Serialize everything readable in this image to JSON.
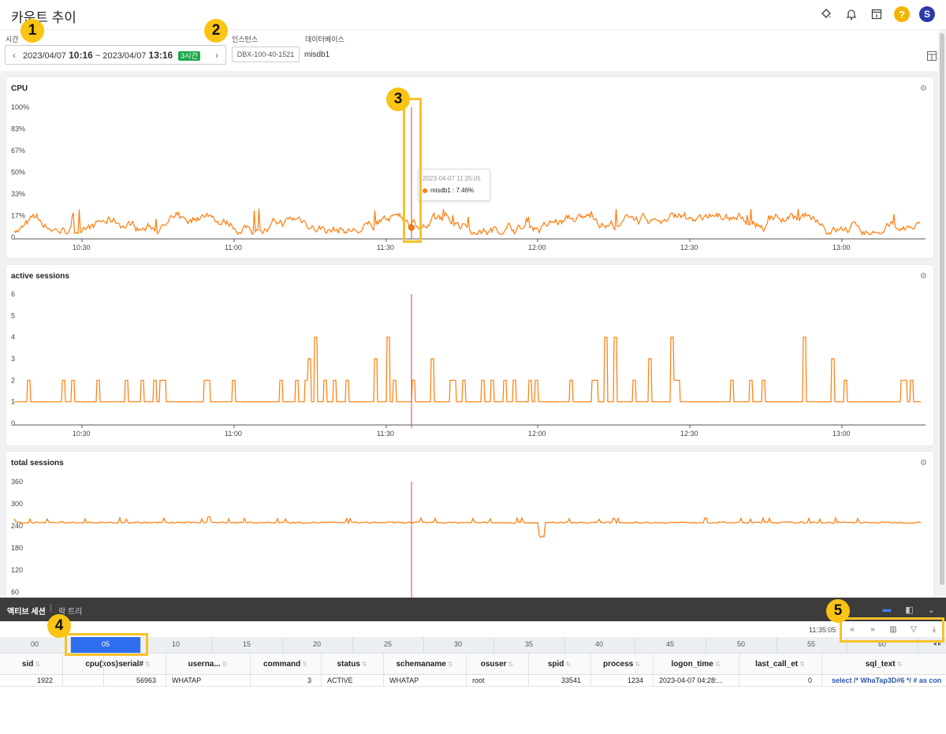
{
  "header": {
    "title": "카운트 추이"
  },
  "filters": {
    "time_label": "시간",
    "time_start_date": "2023/04/07",
    "time_start_hm": "10:16",
    "time_sep": "~",
    "time_end_date": "2023/04/07",
    "time_end_hm": "13:16",
    "time_badge": "3시간",
    "instance_label": "인스턴스",
    "instance_value": "DBX-100-40-1521",
    "database_label": "데이터베이스",
    "database_value": "misdb1"
  },
  "charts": [
    {
      "type": "line",
      "title": "CPU",
      "y_ticks": [
        "100%",
        "83%",
        "67%",
        "50%",
        "33%",
        "17%",
        "0"
      ],
      "ylim": [
        0,
        100
      ],
      "x_ticks": [
        "10:30",
        "11:00",
        "11:30",
        "12:00",
        "12:30",
        "13:00"
      ],
      "series": [
        {
          "values_summary": "fluctuating between 2% and 20%, mostly around 8%"
        }
      ],
      "color": "#ff7c0a"
    },
    {
      "type": "line",
      "title": "active sessions",
      "y_ticks": [
        "6",
        "5",
        "4",
        "3",
        "2",
        "1",
        "0"
      ],
      "ylim": [
        0,
        6
      ],
      "x_ticks": [
        "10:30",
        "11:00",
        "11:30",
        "12:00",
        "12:30",
        "13:00"
      ],
      "color": "#ff7c0a"
    },
    {
      "type": "line",
      "title": "total sessions",
      "y_ticks": [
        "360",
        "300",
        "240",
        "180",
        "120",
        "60"
      ],
      "ylim": [
        60,
        360
      ],
      "x_ticks": [],
      "color": "#ff7c0a"
    }
  ],
  "chart_data": [
    {
      "type": "line",
      "title": "CPU",
      "ylim": [
        0,
        100
      ],
      "yticks": [
        "0",
        "17%",
        "33%",
        "50%",
        "67%",
        "83%",
        "100%"
      ],
      "xticks": [
        "10:30",
        "11:00",
        "11:30",
        "12:00",
        "12:30",
        "13:00"
      ],
      "series": [
        {
          "name": "misdb1",
          "approx_range": [
            2,
            22
          ]
        }
      ],
      "highlight": {
        "time": "2023-04-07 11:35:05",
        "series": "misdb1",
        "value": 7.46
      }
    },
    {
      "type": "line",
      "title": "active sessions",
      "ylim": [
        0,
        6
      ],
      "yticks": [
        "0",
        "1",
        "2",
        "3",
        "4",
        "5",
        "6"
      ],
      "xticks": [
        "10:30",
        "11:00",
        "11:30",
        "12:00",
        "12:30",
        "13:00"
      ],
      "series": [
        {
          "approx_range": [
            1,
            4
          ]
        }
      ]
    },
    {
      "type": "line",
      "title": "total sessions",
      "ylim": [
        60,
        360
      ],
      "yticks": [
        "60",
        "120",
        "180",
        "240",
        "300",
        "360"
      ],
      "series": [
        {
          "approx_range": [
            200,
            265
          ]
        }
      ]
    }
  ],
  "tooltip": {
    "time": "2023-04-07 11:35:05",
    "label": "misdb1 : 7.46%"
  },
  "markers": [
    "1",
    "2",
    "3",
    "4",
    "5"
  ],
  "bottom": {
    "tab_active": "액티브 세션",
    "tab_sep": "|",
    "tab_other": "락 트리",
    "time": "11:35:05",
    "range_ticks": [
      "00",
      "05",
      "10",
      "15",
      "20",
      "25",
      "30",
      "35",
      "40",
      "45",
      "50",
      "55",
      "60"
    ],
    "range_selected": "05"
  },
  "table": {
    "columns": [
      "sid",
      "cpu(xos)",
      "serial#",
      "userna...",
      "command",
      "status",
      "schemaname",
      "osuser",
      "spid",
      "process",
      "logon_time",
      "last_call_et",
      "sql_text"
    ],
    "rows": [
      [
        "1922",
        "",
        "56963",
        "WHATAP",
        "3",
        "ACTIVE",
        "WHATAP",
        "root",
        "33541",
        "1234",
        "2023-04-07 04:28:...",
        "0",
        "select /* WhaTap3D#6 */ # as con"
      ]
    ]
  },
  "colors": {
    "accent": "#ff7c0a",
    "marker": "#f9c414",
    "badge": "#1ea84b",
    "selection": "#2f6fef"
  }
}
